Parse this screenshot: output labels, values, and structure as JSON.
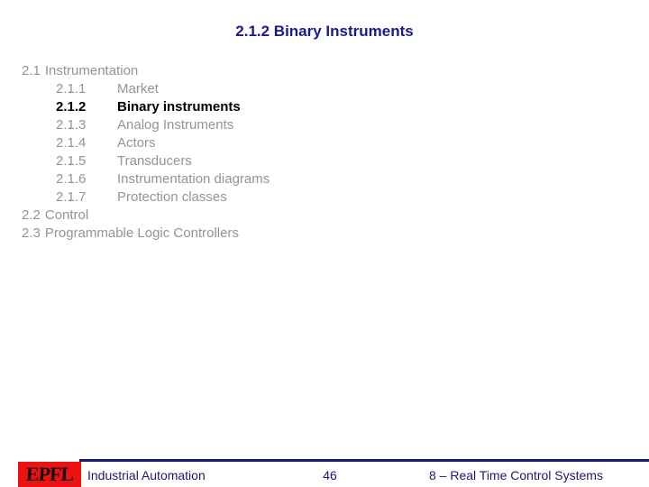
{
  "slide": {
    "title": "2.1.2 Binary Instruments",
    "title_color": "#1a1a8c",
    "background_color": "#ffffff"
  },
  "outline": {
    "default_color": "#949494",
    "emphasis_color": "#000000",
    "rows": [
      {
        "level": 1,
        "num": "2.1",
        "label": "Instrumentation",
        "emphasis": false
      },
      {
        "level": 2,
        "num": "2.1.1",
        "label": "Market",
        "emphasis": false
      },
      {
        "level": 2,
        "num": "2.1.2",
        "label": "Binary instruments",
        "emphasis": true
      },
      {
        "level": 2,
        "num": "2.1.3",
        "label": "Analog Instruments",
        "emphasis": false
      },
      {
        "level": 2,
        "num": "2.1.4",
        "label": "Actors",
        "emphasis": false
      },
      {
        "level": 2,
        "num": "2.1.5",
        "label": "Transducers",
        "emphasis": false
      },
      {
        "level": 2,
        "num": "2.1.6",
        "label": "Instrumentation diagrams",
        "emphasis": false
      },
      {
        "level": 2,
        "num": "2.1.7",
        "label": "Protection classes",
        "emphasis": false
      },
      {
        "level": 1,
        "num": "2.2",
        "label": "Control",
        "emphasis": false
      },
      {
        "level": 1,
        "num": "2.3",
        "label": "Programmable Logic Controllers",
        "emphasis": false
      }
    ]
  },
  "footer": {
    "logo_text": "EPFL",
    "logo_color": "#ee1111",
    "rule_color": "#1a1a6e",
    "text_color": "#1a1a6e",
    "left_text": "Industrial Automation",
    "page_number": "46",
    "right_text": "8 – Real Time Control Systems"
  }
}
